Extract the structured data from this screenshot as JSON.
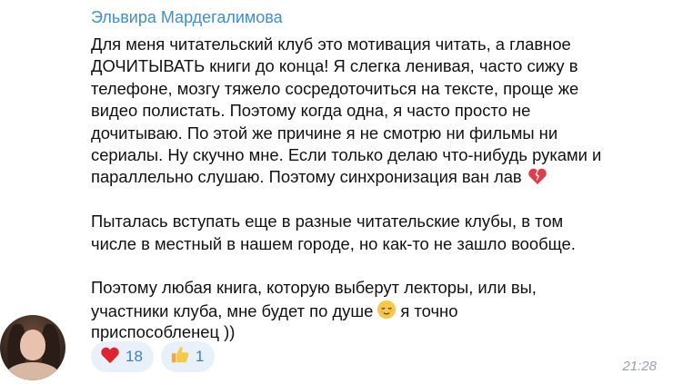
{
  "message": {
    "sender": "Эльвира Мардегалимова",
    "lines": [
      "Для меня читательский клуб это мотивация читать, а главное",
      "ДОЧИТЫВАТЬ книги до конца! Я слегка ленивая, часто сижу в",
      "телефоне, мозгу тяжело сосредоточиться на тексте, проще же",
      "видео полистать. Поэтому когда одна, я часто просто не",
      "дочитываю. По этой же причине я не смотрю ни фильмы ни",
      "сериалы. Ну скучно мне. Если только делаю что-нибудь руками и",
      "параллельно слушаю. Поэтому синхронизация ван лав",
      "",
      "Пыталась вступать еще в разные читательские клубы, в том",
      "числе в местный в нашем городе, но как-то не зашло вообще.",
      "",
      "Поэтому любая книга, которую выберут лекторы, или вы,",
      "участники клуба, мне будет по душе",
      "я точно",
      "приспособленец ))"
    ],
    "inline_emoji": {
      "line7_end": "broken-heart-icon",
      "line13_end": "relieved-face-icon"
    },
    "time": "21:28"
  },
  "reactions": [
    {
      "icon": "heart-icon",
      "count": "18"
    },
    {
      "icon": "thumbs-up-icon",
      "count": "1"
    }
  ],
  "colors": {
    "sender_name": "#3d8fcf",
    "reaction_bg": "#e8f1fa",
    "reaction_count": "#3d7fc0",
    "time": "#9aa0a6"
  }
}
